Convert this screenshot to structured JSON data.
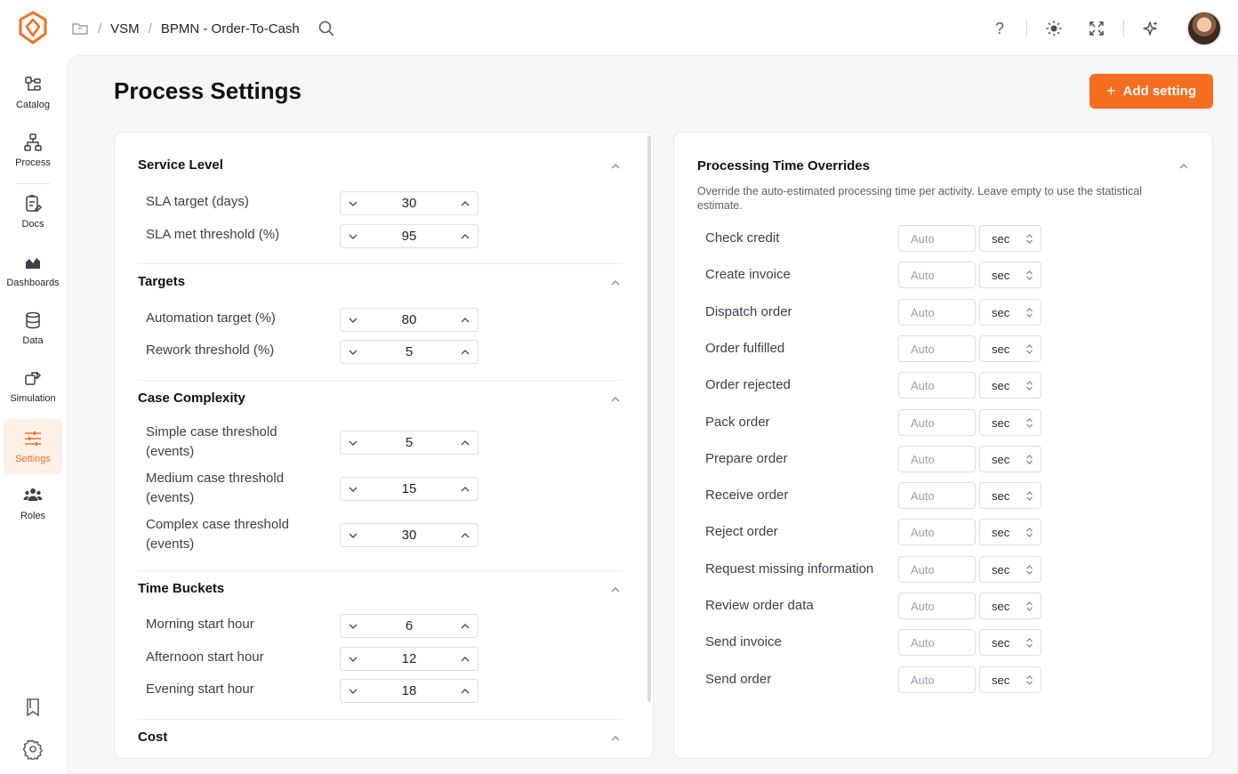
{
  "breadcrumb": {
    "items": [
      "VSM",
      "BPMN - Order-To-Cash"
    ]
  },
  "sidebar": {
    "items": [
      {
        "label": "Catalog"
      },
      {
        "label": "Process"
      },
      {
        "label": "Docs"
      },
      {
        "label": "Dashboards"
      },
      {
        "label": "Data"
      },
      {
        "label": "Simulation"
      },
      {
        "label": "Settings",
        "active": true
      },
      {
        "label": "Roles"
      }
    ]
  },
  "page": {
    "title": "Process Settings",
    "add_button": "Add setting"
  },
  "sections": [
    {
      "title": "Service Level",
      "fields": [
        {
          "label": "SLA target (days)",
          "value": "30"
        },
        {
          "label": "SLA met threshold (%)",
          "value": "95"
        }
      ]
    },
    {
      "title": "Targets",
      "fields": [
        {
          "label": "Automation target (%)",
          "value": "80"
        },
        {
          "label": "Rework threshold (%)",
          "value": "5"
        }
      ]
    },
    {
      "title": "Case Complexity",
      "fields": [
        {
          "label": "Simple case threshold (events)",
          "value": "5"
        },
        {
          "label": "Medium case threshold (events)",
          "value": "15"
        },
        {
          "label": "Complex case threshold (events)",
          "value": "30"
        }
      ]
    },
    {
      "title": "Time Buckets",
      "fields": [
        {
          "label": "Morning start hour",
          "value": "6"
        },
        {
          "label": "Afternoon start hour",
          "value": "12"
        },
        {
          "label": "Evening start hour",
          "value": "18"
        }
      ]
    },
    {
      "title": "Cost",
      "fields": []
    }
  ],
  "overrides": {
    "title": "Processing Time Overrides",
    "description": "Override the auto-estimated processing time per activity. Leave empty to use the statistical estimate.",
    "placeholder": "Auto",
    "unit": "sec",
    "activities": [
      "Check credit",
      "Create invoice",
      "Dispatch order",
      "Order fulfilled",
      "Order rejected",
      "Pack order",
      "Prepare order",
      "Receive order",
      "Reject order",
      "Request missing information",
      "Review order data",
      "Send invoice",
      "Send order"
    ]
  },
  "colors": {
    "accent": "#f56e1f",
    "active_bg": "#fff1e8"
  }
}
